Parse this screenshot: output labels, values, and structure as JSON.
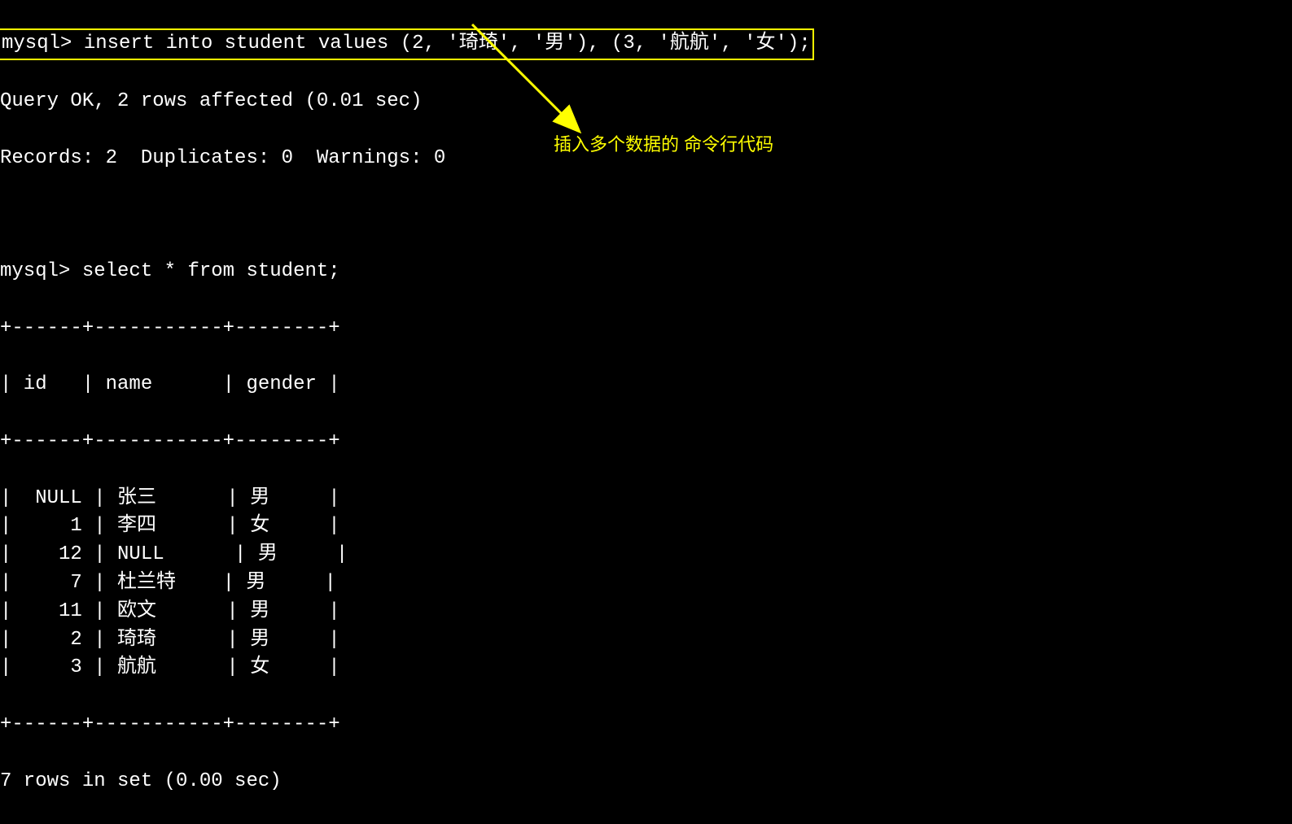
{
  "prompt": "mysql>",
  "insert_cmd": " insert into student values (2, '琦琦', '男'), (3, '航航', '女');",
  "result_line1": "Query OK, 2 rows affected (0.01 sec)",
  "result_line2": "Records: 2  Duplicates: 0  Warnings: 0",
  "select_cmd": " select * from student;",
  "table_border": "+------+-----------+--------+",
  "header": {
    "id": "id",
    "name": "name",
    "gender": "gender"
  },
  "rows": [
    {
      "id": "NULL",
      "name": "张三",
      "gender": "男"
    },
    {
      "id": "1",
      "name": "李四",
      "gender": "女"
    },
    {
      "id": "12",
      "name": "NULL",
      "gender": "男"
    },
    {
      "id": "7",
      "name": "杜兰特",
      "gender": "男"
    },
    {
      "id": "11",
      "name": "欧文",
      "gender": "男"
    },
    {
      "id": "2",
      "name": "琦琦",
      "gender": "男"
    },
    {
      "id": "3",
      "name": "航航",
      "gender": "女"
    }
  ],
  "footer": "7 rows in set (0.00 sec)",
  "annotation": "插入多个数据的 命令行代码",
  "arrow_color": "#ffff00"
}
